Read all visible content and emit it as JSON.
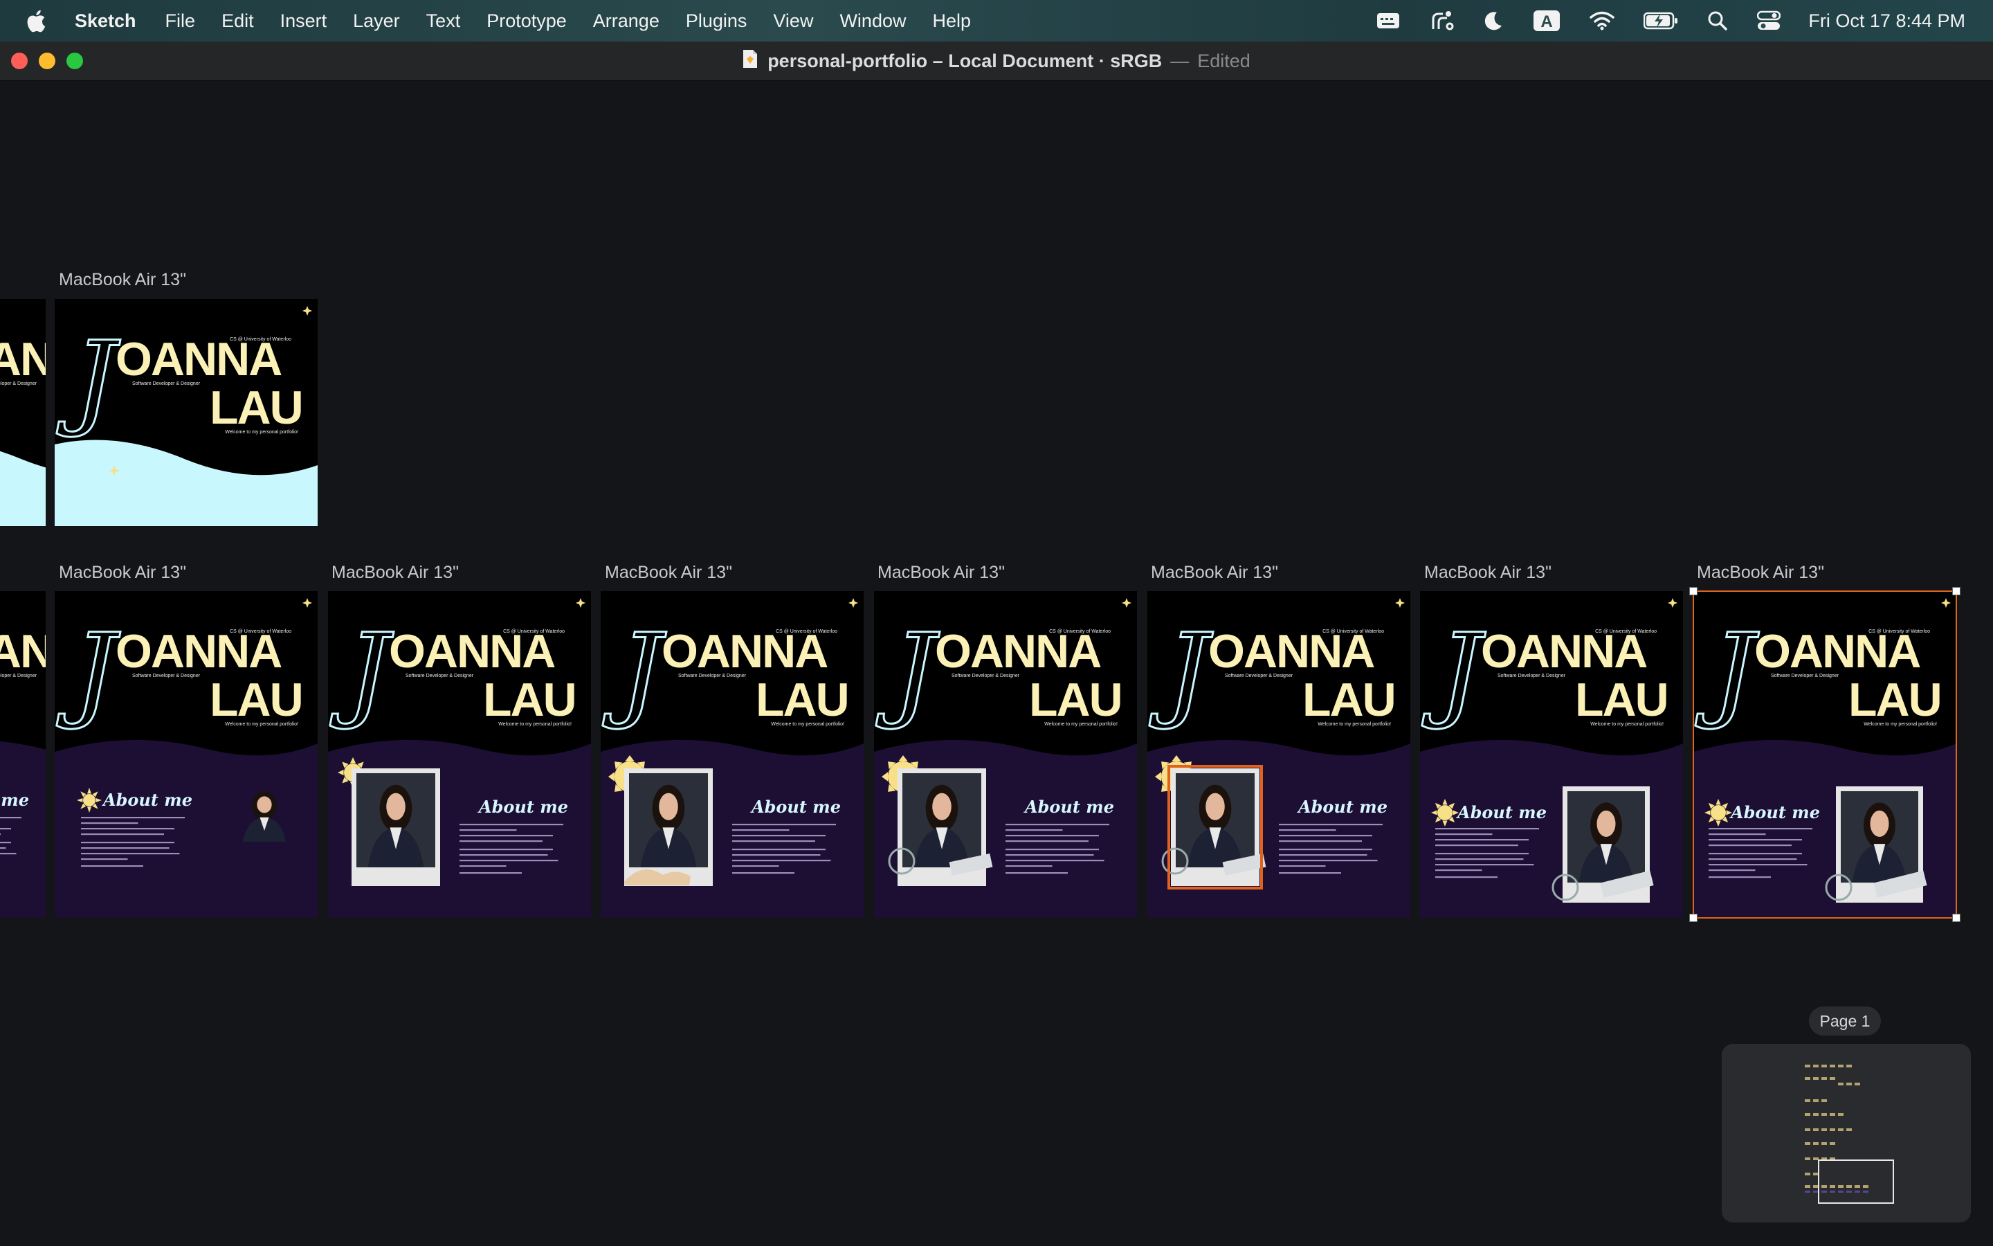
{
  "menubar": {
    "app_name": "Sketch",
    "items": [
      "File",
      "Edit",
      "Insert",
      "Layer",
      "Text",
      "Prototype",
      "Arrange",
      "Plugins",
      "View",
      "Window",
      "Help"
    ],
    "clock": "Fri Oct 17  8:44 PM",
    "input_source": "A",
    "status_icons": [
      "menu-extras-icon",
      "cleanmymac-icon",
      "focus-moon-icon",
      "input-source-icon",
      "wifi-icon",
      "battery-charging-icon",
      "spotlight-search-icon",
      "control-center-icon"
    ]
  },
  "window": {
    "document_name": "personal-portfolio – Local Document · sRGB",
    "separator": "—",
    "status": "Edited"
  },
  "canvas": {
    "artboard_label": "MacBook Air 13\"",
    "page_label": "Page 1",
    "selection_color": "#e0621f"
  },
  "artboard_art": {
    "name_top": "OANNA",
    "name_bottom": "LAU",
    "script_initials": "J",
    "school_line": "CS @ University of Waterloo",
    "role_line": "Software Developer & Designer",
    "welcome_line": "Welcome to my personal portfolio!",
    "about_heading": "About me",
    "colors": {
      "name_fill": "#fbf1b6",
      "script": "#c9f6ff",
      "wave_light": "#c8f8fd",
      "wave_dark": "#1c0f33",
      "sun": "#f8e088"
    }
  }
}
